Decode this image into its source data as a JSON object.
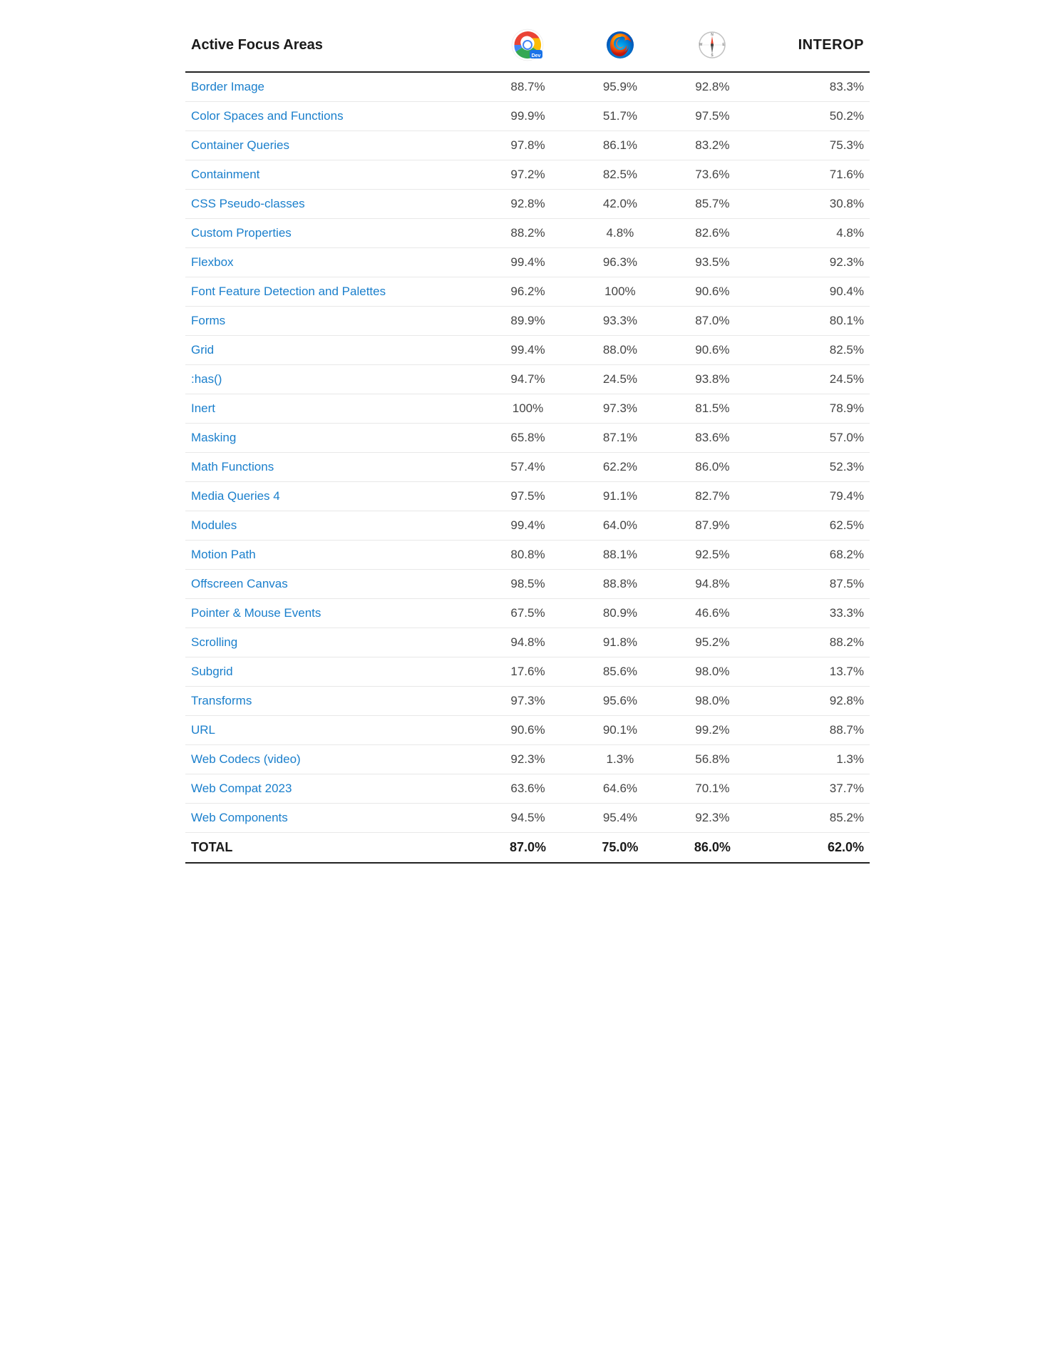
{
  "header": {
    "area_col_label": "Active Focus Areas",
    "interop_col_label": "INTEROP"
  },
  "browsers": [
    {
      "name": "Chrome Dev",
      "type": "chrome-dev"
    },
    {
      "name": "Firefox",
      "type": "firefox"
    },
    {
      "name": "Safari",
      "type": "safari"
    }
  ],
  "rows": [
    {
      "area": "Border Image",
      "chrome": "88.7%",
      "firefox": "95.9%",
      "safari": "92.8%",
      "interop": "83.3%"
    },
    {
      "area": "Color Spaces and Functions",
      "chrome": "99.9%",
      "firefox": "51.7%",
      "safari": "97.5%",
      "interop": "50.2%"
    },
    {
      "area": "Container Queries",
      "chrome": "97.8%",
      "firefox": "86.1%",
      "safari": "83.2%",
      "interop": "75.3%"
    },
    {
      "area": "Containment",
      "chrome": "97.2%",
      "firefox": "82.5%",
      "safari": "73.6%",
      "interop": "71.6%"
    },
    {
      "area": "CSS Pseudo-classes",
      "chrome": "92.8%",
      "firefox": "42.0%",
      "safari": "85.7%",
      "interop": "30.8%"
    },
    {
      "area": "Custom Properties",
      "chrome": "88.2%",
      "firefox": "4.8%",
      "safari": "82.6%",
      "interop": "4.8%"
    },
    {
      "area": "Flexbox",
      "chrome": "99.4%",
      "firefox": "96.3%",
      "safari": "93.5%",
      "interop": "92.3%"
    },
    {
      "area": "Font Feature Detection and Palettes",
      "chrome": "96.2%",
      "firefox": "100%",
      "safari": "90.6%",
      "interop": "90.4%"
    },
    {
      "area": "Forms",
      "chrome": "89.9%",
      "firefox": "93.3%",
      "safari": "87.0%",
      "interop": "80.1%"
    },
    {
      "area": "Grid",
      "chrome": "99.4%",
      "firefox": "88.0%",
      "safari": "90.6%",
      "interop": "82.5%"
    },
    {
      "area": ":has()",
      "chrome": "94.7%",
      "firefox": "24.5%",
      "safari": "93.8%",
      "interop": "24.5%"
    },
    {
      "area": "Inert",
      "chrome": "100%",
      "firefox": "97.3%",
      "safari": "81.5%",
      "interop": "78.9%"
    },
    {
      "area": "Masking",
      "chrome": "65.8%",
      "firefox": "87.1%",
      "safari": "83.6%",
      "interop": "57.0%"
    },
    {
      "area": "Math Functions",
      "chrome": "57.4%",
      "firefox": "62.2%",
      "safari": "86.0%",
      "interop": "52.3%"
    },
    {
      "area": "Media Queries 4",
      "chrome": "97.5%",
      "firefox": "91.1%",
      "safari": "82.7%",
      "interop": "79.4%"
    },
    {
      "area": "Modules",
      "chrome": "99.4%",
      "firefox": "64.0%",
      "safari": "87.9%",
      "interop": "62.5%"
    },
    {
      "area": "Motion Path",
      "chrome": "80.8%",
      "firefox": "88.1%",
      "safari": "92.5%",
      "interop": "68.2%"
    },
    {
      "area": "Offscreen Canvas",
      "chrome": "98.5%",
      "firefox": "88.8%",
      "safari": "94.8%",
      "interop": "87.5%"
    },
    {
      "area": "Pointer & Mouse Events",
      "chrome": "67.5%",
      "firefox": "80.9%",
      "safari": "46.6%",
      "interop": "33.3%"
    },
    {
      "area": "Scrolling",
      "chrome": "94.8%",
      "firefox": "91.8%",
      "safari": "95.2%",
      "interop": "88.2%"
    },
    {
      "area": "Subgrid",
      "chrome": "17.6%",
      "firefox": "85.6%",
      "safari": "98.0%",
      "interop": "13.7%"
    },
    {
      "area": "Transforms",
      "chrome": "97.3%",
      "firefox": "95.6%",
      "safari": "98.0%",
      "interop": "92.8%"
    },
    {
      "area": "URL",
      "chrome": "90.6%",
      "firefox": "90.1%",
      "safari": "99.2%",
      "interop": "88.7%"
    },
    {
      "area": "Web Codecs (video)",
      "chrome": "92.3%",
      "firefox": "1.3%",
      "safari": "56.8%",
      "interop": "1.3%"
    },
    {
      "area": "Web Compat 2023",
      "chrome": "63.6%",
      "firefox": "64.6%",
      "safari": "70.1%",
      "interop": "37.7%"
    },
    {
      "area": "Web Components",
      "chrome": "94.5%",
      "firefox": "95.4%",
      "safari": "92.3%",
      "interop": "85.2%"
    }
  ],
  "total": {
    "label": "TOTAL",
    "chrome": "87.0%",
    "firefox": "75.0%",
    "safari": "86.0%",
    "interop": "62.0%"
  }
}
